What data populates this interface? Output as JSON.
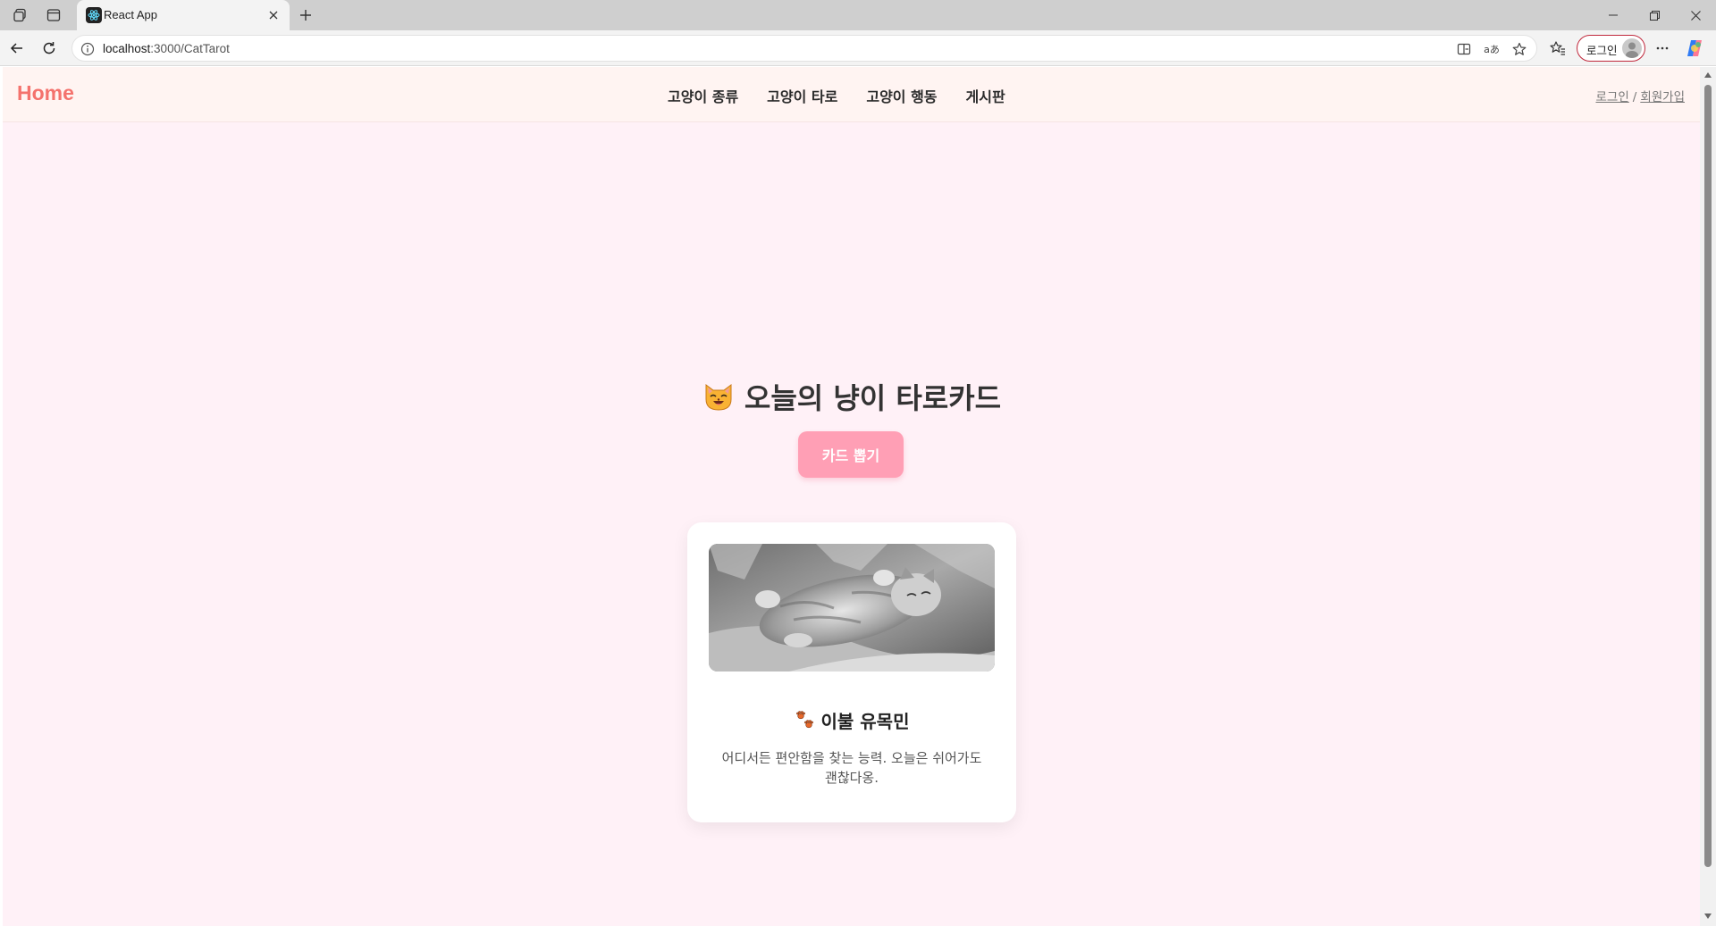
{
  "browser": {
    "tab_title": "React App",
    "url_host": "localhost",
    "url_rest": ":3000/CatTarot",
    "profile_label": "로그인"
  },
  "navbar": {
    "brand": "Home",
    "menu": [
      "고양이 종류",
      "고양이 타로",
      "고양이 행동",
      "게시판"
    ],
    "login": "로그인",
    "separator": "/",
    "signup": "회원가입"
  },
  "main": {
    "title": "오늘의 냥이 타로카드",
    "draw_button": "카드 뽑기",
    "card": {
      "title": "이불 유목민",
      "description": "어디서든 편안함을 찾는 능력. 오늘은 쉬어가도 괜찮다옹."
    }
  },
  "colors": {
    "brand": "#f4726d",
    "button": "#ff9fb5",
    "page_bg": "#fff1f7",
    "navbar_bg": "#fff4f2"
  },
  "icons": [
    "workspaces-icon",
    "vertical-tabs-icon",
    "react-favicon-icon",
    "close-tab-icon",
    "new-tab-icon",
    "minimize-icon",
    "restore-icon",
    "close-window-icon",
    "back-icon",
    "refresh-icon",
    "site-info-icon",
    "split-screen-icon",
    "read-aloud-icon",
    "favorite-star-icon",
    "favorites-icon",
    "more-icon",
    "copilot-icon",
    "cat-face-icon",
    "paw-prints-icon"
  ]
}
